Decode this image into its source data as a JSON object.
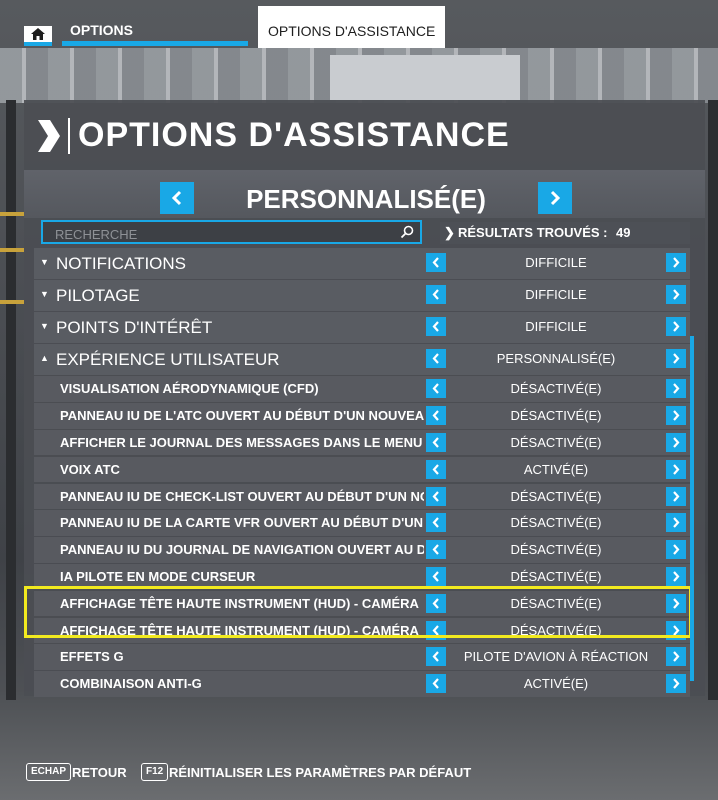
{
  "nav": {
    "tab_options": "OPTIONS",
    "tab_active": "OPTIONS D'ASSISTANCE"
  },
  "page": {
    "title": "OPTIONS D'ASSISTANCE"
  },
  "preset": {
    "value": "PERSONNALISÉ(E)"
  },
  "search": {
    "placeholder": "RECHERCHE",
    "value": ""
  },
  "results": {
    "label": "RÉSULTATS TROUVÉS :",
    "count": "49"
  },
  "rows": [
    {
      "type": "category",
      "label": "NOTIFICATIONS",
      "value": "DIFFICILE",
      "expanded": false
    },
    {
      "type": "category",
      "label": "PILOTAGE",
      "value": "DIFFICILE",
      "expanded": false
    },
    {
      "type": "category",
      "label": "POINTS D'INTÉRÊT",
      "value": "DIFFICILE",
      "expanded": false
    },
    {
      "type": "category",
      "label": "EXPÉRIENCE UTILISATEUR",
      "value": "PERSONNALISÉ(E)",
      "expanded": true
    },
    {
      "type": "setting",
      "label": "VISUALISATION AÉRODYNAMIQUE (CFD)",
      "value": "DÉSACTIVÉ(E)"
    },
    {
      "type": "setting",
      "label": "PANNEAU IU DE L'ATC OUVERT AU DÉBUT D'UN NOUVEAU",
      "value": "DÉSACTIVÉ(E)"
    },
    {
      "type": "setting",
      "label": "AFFICHER LE JOURNAL DES MESSAGES DANS LE MENU A",
      "value": "DÉSACTIVÉ(E)"
    },
    {
      "type": "setting",
      "label": "VOIX ATC",
      "value": "ACTIVÉ(E)"
    },
    {
      "type": "setting",
      "label": "PANNEAU IU DE CHECK-LIST OUVERT AU DÉBUT D'UN NO",
      "value": "DÉSACTIVÉ(E)"
    },
    {
      "type": "setting",
      "label": "PANNEAU IU DE LA CARTE VFR OUVERT AU DÉBUT D'UN N",
      "value": "DÉSACTIVÉ(E)"
    },
    {
      "type": "setting",
      "label": "PANNEAU IU DU JOURNAL DE NAVIGATION OUVERT AU D",
      "value": "DÉSACTIVÉ(E)"
    },
    {
      "type": "setting",
      "label": "IA PILOTE EN MODE CURSEUR",
      "value": "DÉSACTIVÉ(E)"
    },
    {
      "type": "setting",
      "label": "AFFICHAGE TÊTE HAUTE INSTRUMENT (HUD) - CAMÉRA",
      "value": "DÉSACTIVÉ(E)"
    },
    {
      "type": "setting",
      "label": "AFFICHAGE TÊTE HAUTE INSTRUMENT (HUD) - CAMÉRA",
      "value": "DÉSACTIVÉ(E)"
    },
    {
      "type": "setting",
      "label": "EFFETS G",
      "value": "PILOTE D'AVION À RÉACTION"
    },
    {
      "type": "setting",
      "label": "COMBINAISON ANTI-G",
      "value": "ACTIVÉ(E)"
    }
  ],
  "footer": {
    "back_key": "ECHAP",
    "back_label": "RETOUR",
    "reset_key": "F12",
    "reset_label": "RÉINITIALISER LES PARAMÈTRES PAR DÉFAUT"
  },
  "icons": {
    "home": "home-icon",
    "title": "chevron-right-icon",
    "search": "search-icon",
    "prev": "chevron-left-icon",
    "next": "chevron-right-icon"
  },
  "colors": {
    "accent": "#19a8e6",
    "highlight": "#f2ea1f"
  }
}
